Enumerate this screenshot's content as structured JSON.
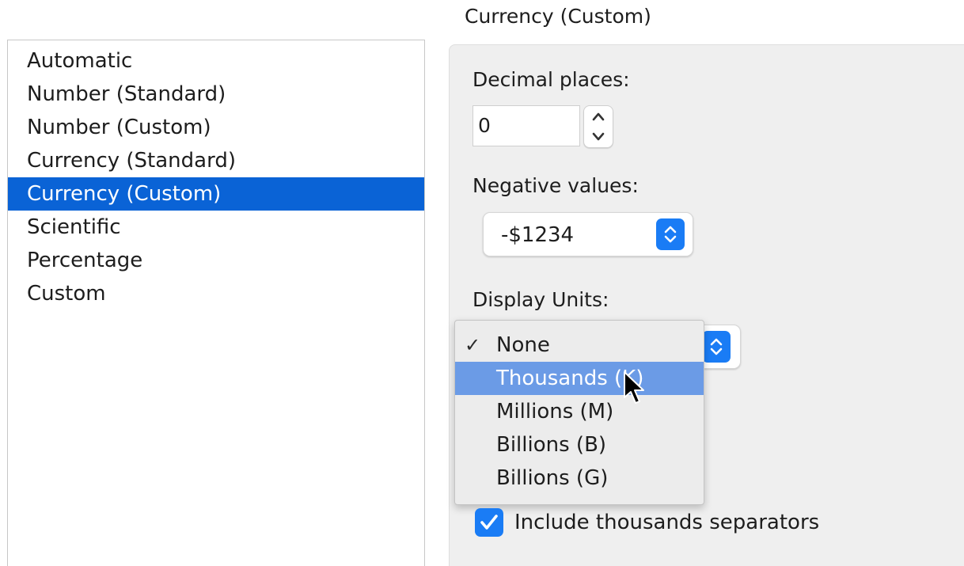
{
  "category_list": {
    "items": [
      {
        "label": "Automatic",
        "selected": false
      },
      {
        "label": "Number (Standard)",
        "selected": false
      },
      {
        "label": "Number (Custom)",
        "selected": false
      },
      {
        "label": "Currency (Standard)",
        "selected": false
      },
      {
        "label": "Currency (Custom)",
        "selected": true
      },
      {
        "label": "Scientific",
        "selected": false
      },
      {
        "label": "Percentage",
        "selected": false
      },
      {
        "label": "Custom",
        "selected": false
      }
    ]
  },
  "panel": {
    "title": "Currency (Custom)",
    "decimal_places": {
      "label": "Decimal places:",
      "value": "0"
    },
    "negative_values": {
      "label": "Negative values:",
      "value": "-$1234"
    },
    "display_units": {
      "label": "Display Units:",
      "menu_open": true,
      "options": [
        {
          "label": "None",
          "checked": true,
          "highlighted": false
        },
        {
          "label": "Thousands (K)",
          "checked": false,
          "highlighted": true
        },
        {
          "label": "Millions (M)",
          "checked": false,
          "highlighted": false
        },
        {
          "label": "Billions (B)",
          "checked": false,
          "highlighted": false
        },
        {
          "label": "Billions (G)",
          "checked": false,
          "highlighted": false
        }
      ],
      "check_glyph": "✓"
    },
    "thousands_separator": {
      "label": "Include thousands separators",
      "checked": true
    }
  },
  "colors": {
    "selection_blue": "#0a63d6",
    "accent_blue": "#1a7cf5",
    "menu_highlight": "#6b9be6",
    "panel_background": "#efefef"
  },
  "icons": {
    "stepper_up": "chevron-up-icon",
    "stepper_down": "chevron-down-icon",
    "popup_arrows": "up-down-chevron-icon",
    "checkbox": "checkmark-icon",
    "cursor": "arrow-cursor-icon"
  }
}
